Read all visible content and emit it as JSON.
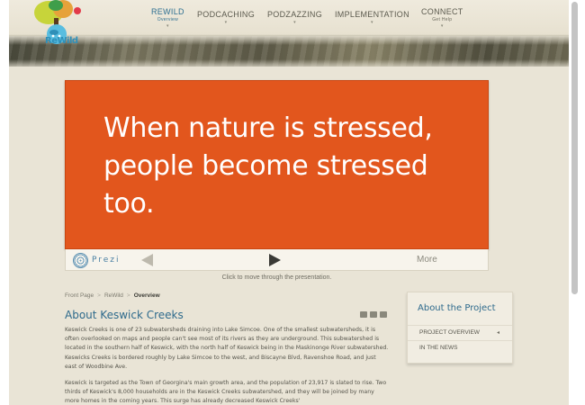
{
  "logo": {
    "text": "ReWild",
    "icon": "tree-globe-logo-icon"
  },
  "nav": {
    "items": [
      {
        "label": "REWILD",
        "sub": "Overview",
        "active": true
      },
      {
        "label": "PODCACHING",
        "sub": "",
        "active": false
      },
      {
        "label": "PODZAZZING",
        "sub": "",
        "active": false
      },
      {
        "label": "IMPLEMENTATION",
        "sub": "",
        "active": false
      },
      {
        "label": "CONNECT",
        "sub": "Get Help",
        "active": false
      }
    ],
    "caret": "▾"
  },
  "slide": {
    "text": "When nature is stressed, people become stressed too.",
    "background": "#e2561d"
  },
  "player": {
    "brand": "Prezi",
    "more_label": "More",
    "caption": "Click to move through the presentation."
  },
  "breadcrumb": {
    "items": [
      "Front Page",
      "ReWild",
      "Overview"
    ],
    "separator": ">"
  },
  "article": {
    "title": "About Keswick Creeks",
    "paragraphs": [
      "Keswick Creeks is one of 23 subwatersheds draining into Lake Simcoe. One of the smallest subwatersheds, it is often overlooked on maps and people can't see most of its rivers as they are underground. This subwatershed is located in the southern half of Keswick, with the north half of Keswick being in the Maskinonge River subwatershed. Keswicks Creeks is bordered roughly by Lake Simcoe to the west, and Biscayne Blvd, Ravenshoe Road, and just east of Woodbine Ave.",
      "Keswick is targeted as the Town of Georgina's main growth area, and the population of 23,917 is slated to rise. Two thirds of Keswick's 8,000 households are in the Keswick Creeks subwatershed, and they will be joined by many more homes in the coming years. This surge has already decreased Keswick Creeks'"
    ]
  },
  "aside": {
    "title": "About the Project",
    "items": [
      {
        "label": "PROJECT OVERVIEW",
        "chevron": "◂"
      },
      {
        "label": "IN THE NEWS",
        "chevron": ""
      }
    ]
  },
  "colors": {
    "accent": "#2e6a8c",
    "page_bg": "#e9e4d6",
    "slide_orange": "#e2561d"
  }
}
